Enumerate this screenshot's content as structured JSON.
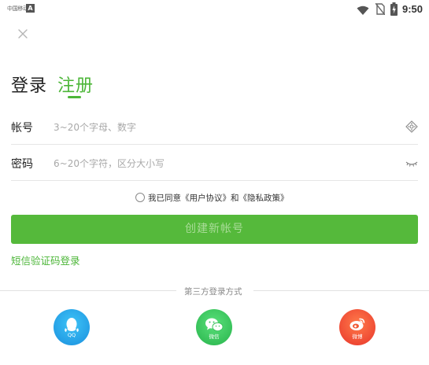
{
  "status_bar": {
    "carrier": "中国移动",
    "notification_icon": "A",
    "time": "9:50"
  },
  "tabs": {
    "login": "登录",
    "register": "注册"
  },
  "form": {
    "account_label": "帐号",
    "account_placeholder": "3~20个字母、数字",
    "password_label": "密码",
    "password_placeholder": "6~20个字符，区分大小写"
  },
  "agreement": "我已同意《用户协议》和《隐私政策》",
  "create_button": "创建新帐号",
  "sms_login": "短信验证码登录",
  "third_party": {
    "title": "第三方登录方式",
    "qq": "QQ",
    "wechat": "微信",
    "weibo": "微博"
  },
  "colors": {
    "accent": "#4cb638",
    "button": "#55b93b"
  }
}
